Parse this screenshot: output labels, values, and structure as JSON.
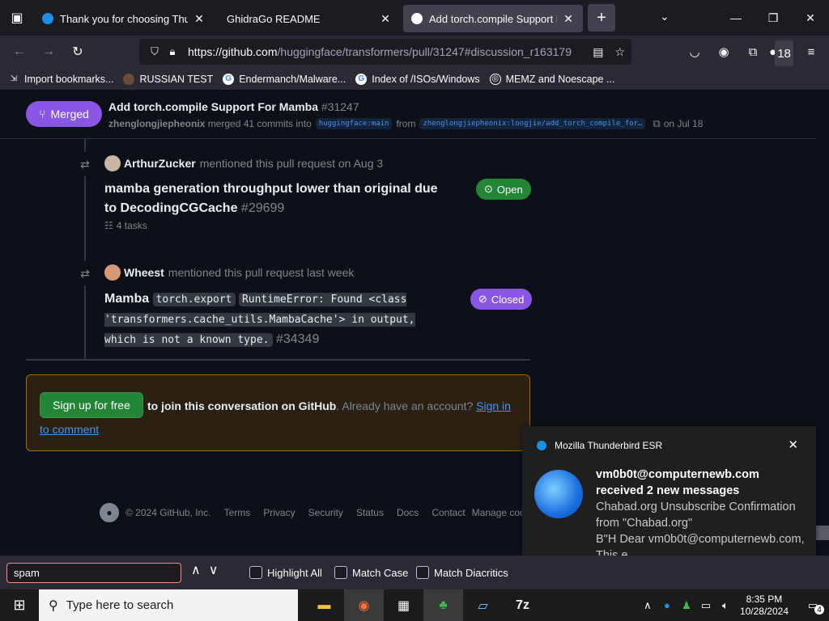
{
  "tabs": [
    {
      "title": "Thank you for choosing Thunde",
      "favicon_color": "#1b8ee6"
    },
    {
      "title": "GhidraGo README",
      "favicon_color": ""
    },
    {
      "title": "Add torch.compile Support For",
      "favicon_color": "#ffffff"
    }
  ],
  "url": {
    "domain": "https://github.com",
    "path": "/huggingface/transformers/pull/31247#discussion_r163179"
  },
  "bookmarks": [
    {
      "label": "Import bookmarks...",
      "icon": "import-icon"
    },
    {
      "label": "RUSSIAN TEST",
      "icon": "avatar-icon"
    },
    {
      "label": "Endermanch/Malware...",
      "icon": "google-icon"
    },
    {
      "label": "Index of /ISOs/Windows",
      "icon": "google-icon"
    },
    {
      "label": "MEMZ and Noescape ...",
      "icon": "globe-icon"
    }
  ],
  "extensions_badge": "18",
  "pr": {
    "state": "Merged",
    "title": "Add torch.compile Support For Mamba",
    "number": "#31247",
    "author": "zhenglongjiepheonix",
    "merged_text": "merged 41 commits into",
    "base_branch": "huggingface:main",
    "from_text": "from",
    "head_branch": "zhenglongjiepheonix:longjie/add_torch_compile_for…",
    "date": "on Jul 18"
  },
  "timeline": [
    {
      "user": "ArthurZucker",
      "action": "mentioned this pull request on Aug 3",
      "title": "mamba generation throughput lower than original due to DecodingCGCache",
      "number": "#29699",
      "state": "Open",
      "tasks": "4 tasks"
    },
    {
      "user": "Wheest",
      "action": "mentioned this pull request last week",
      "title_prefix": "Mamba",
      "code1": "torch.export",
      "code2": "RuntimeError: Found <class 'transformers.cache_utils.MambaCache'> in output, which is not a known type.",
      "number": "#34349",
      "state": "Closed"
    }
  ],
  "signup": {
    "button": "Sign up for free",
    "bold": "to join this conversation on GitHub",
    "mid": ". Already have an account?",
    "link": "Sign in to comment"
  },
  "footer": {
    "copyright": "© 2024 GitHub, Inc.",
    "links": [
      "Terms",
      "Privacy",
      "Security",
      "Status",
      "Docs",
      "Contact",
      "Manage cook"
    ]
  },
  "toast": {
    "app": "Mozilla Thunderbird ESR",
    "line1": "vm0b0t@computernewb.com",
    "line2": "received 2 new messages",
    "line3": "Chabad.org Unsubscribe Confirmation from \"Chabad.org\"",
    "line4": "B\"H Dear vm0b0t@computernewb.com, This e"
  },
  "findbar": {
    "query": "spam",
    "options": [
      "Highlight All",
      "Match Case",
      "Match Diacritics"
    ]
  },
  "taskbar": {
    "search_placeholder": "Type here to search",
    "time": "8:35 PM",
    "date": "10/28/2024",
    "notif_count": "4"
  },
  "colors": {
    "merged": "#8957e5",
    "open": "#238636",
    "link": "#4493f8"
  }
}
